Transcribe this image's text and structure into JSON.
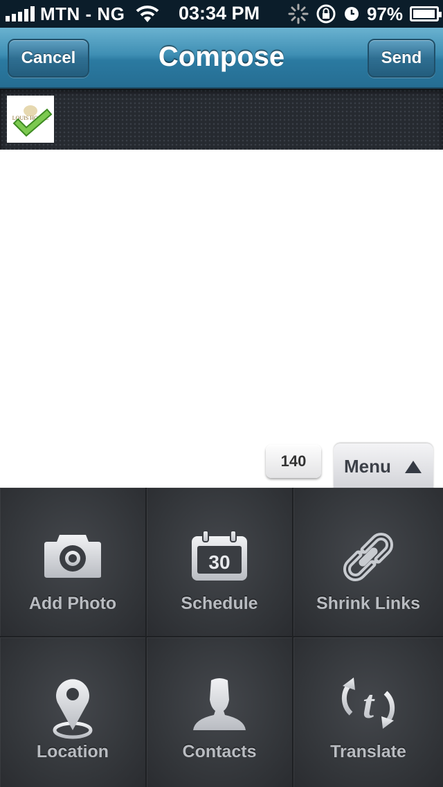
{
  "status_bar": {
    "carrier": "MTN - NG",
    "time": "03:34 PM",
    "battery_percent": "97%",
    "signal_bars": 5,
    "icons": [
      "signal-icon",
      "wifi-icon",
      "activity-spinner-icon",
      "orientation-lock-icon",
      "alarm-clock-icon",
      "battery-charging-icon"
    ]
  },
  "navbar": {
    "title": "Compose",
    "cancel_label": "Cancel",
    "send_label": "Send",
    "color": "#3f8fb4"
  },
  "account": {
    "avatar_text": "LOUIS HOLDE",
    "selected_icon": "checkmark-icon"
  },
  "compose": {
    "char_count": "140",
    "menu_label": "Menu"
  },
  "menu": {
    "items": [
      {
        "label": "Add Photo",
        "icon": "camera-icon"
      },
      {
        "label": "Schedule",
        "icon": "calendar-icon",
        "icon_text": "30"
      },
      {
        "label": "Shrink Links",
        "icon": "link-icon"
      },
      {
        "label": "Location",
        "icon": "location-pin-icon"
      },
      {
        "label": "Contacts",
        "icon": "contact-person-icon"
      },
      {
        "label": "Translate",
        "icon": "translate-icon"
      }
    ]
  }
}
